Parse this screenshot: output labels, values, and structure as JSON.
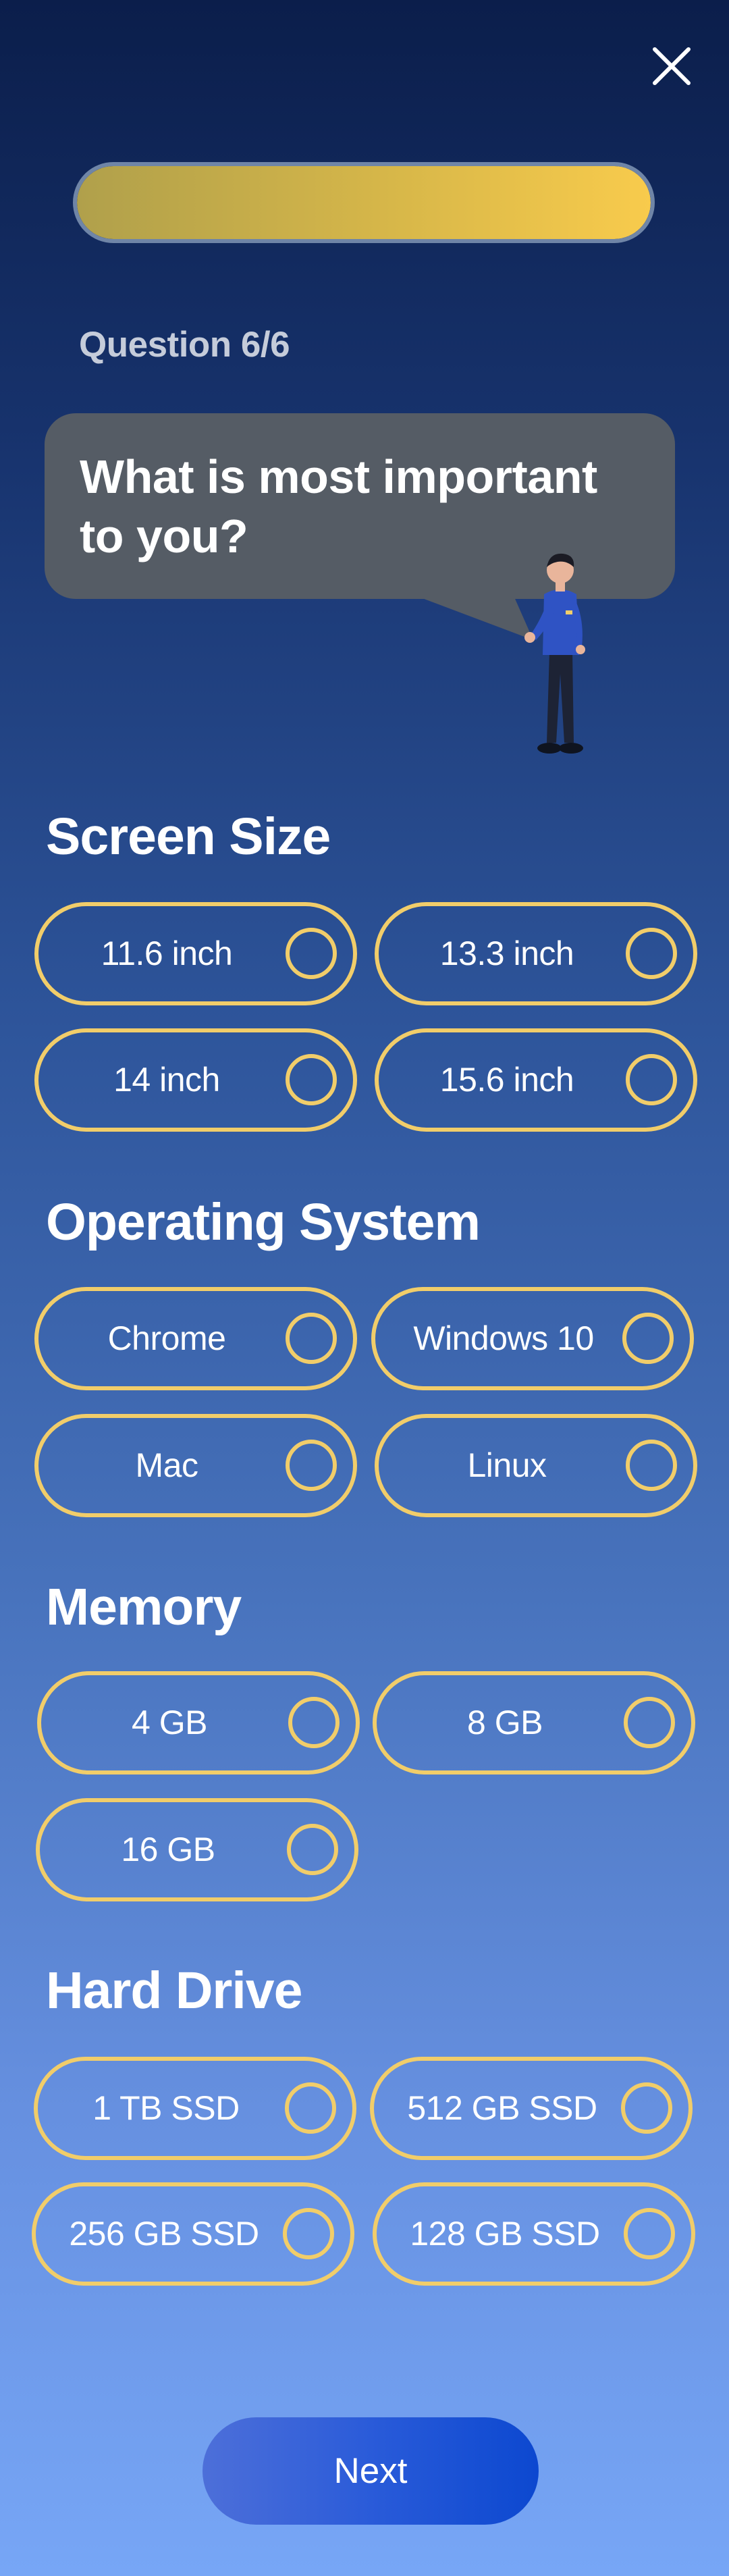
{
  "header": {
    "close_icon": "close-icon"
  },
  "progress": {
    "value": 1.0,
    "color_start": "#b0a04b",
    "color_end": "#f8cb4c"
  },
  "question": {
    "counter": "Question 6/6",
    "text": "What is most important to you?"
  },
  "sections": [
    {
      "title": "Screen Size",
      "options": [
        "11.6 inch",
        "13.3 inch",
        "14 inch",
        "15.6 inch"
      ]
    },
    {
      "title": "Operating System",
      "options": [
        "Chrome",
        "Windows 10",
        "Mac",
        "Linux"
      ]
    },
    {
      "title": "Memory",
      "options": [
        "4 GB",
        "8 GB",
        "16 GB"
      ]
    },
    {
      "title": "Hard Drive",
      "options": [
        "1 TB SSD",
        "512 GB SSD",
        "256 GB SSD",
        "128 GB SSD"
      ]
    }
  ],
  "footer": {
    "next_label": "Next"
  },
  "colors": {
    "accent": "#f1cd6a",
    "bubble": "#555c65",
    "button": "#2a5bd9"
  }
}
